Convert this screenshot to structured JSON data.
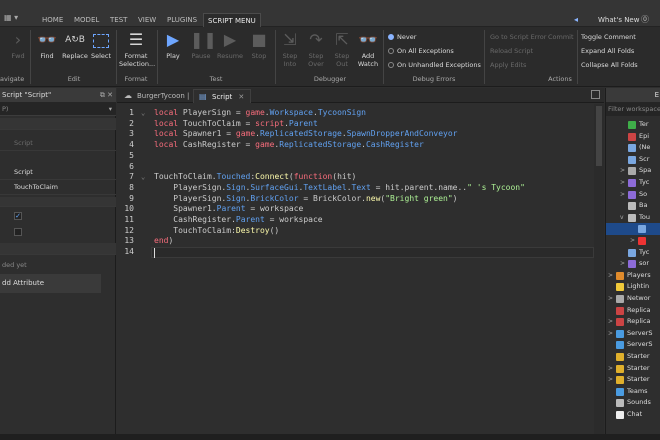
{
  "menubar": {
    "tabs": [
      "HOME",
      "MODEL",
      "TEST",
      "VIEW",
      "PLUGINS",
      "SCRIPT MENU"
    ],
    "active_tab": "SCRIPT MENU",
    "whats_new": "What's New"
  },
  "ribbon": {
    "navigate": {
      "fwd_label": "Fwd",
      "group": "avigate"
    },
    "edit": {
      "find": "Find",
      "replace": "Replace",
      "select": "Select",
      "group": "Edit"
    },
    "format": {
      "format_selection": "Format Selection...",
      "group": "Format"
    },
    "test": {
      "play": "Play",
      "pause": "Pause",
      "resume": "Resume",
      "stop": "Stop",
      "group": "Test"
    },
    "debugger": {
      "step_into": "Step Into",
      "step_over": "Step Over",
      "step_out": "Step Out",
      "add_watch": "Add Watch",
      "group": "Debugger"
    },
    "debug_errors": {
      "never": "Never",
      "all": "On All Exceptions",
      "unhandled": "On Unhandled Exceptions",
      "group": "Debug Errors"
    },
    "actions": {
      "goto": "Go to Script Error",
      "commit": "Commit",
      "reload": "Reload Script",
      "apply": "Apply Edits",
      "group": "Actions"
    },
    "folds": {
      "toggle": "Toggle Comment",
      "expand": "Expand All Folds",
      "collapse": "Collapse All Folds"
    }
  },
  "properties": {
    "title": "Script \"Script\"",
    "filter": "P)",
    "rows": [
      "Script",
      "Script",
      "TouchToClaim"
    ],
    "not_added": "ded yet",
    "add_attribute": "dd Attribute"
  },
  "editor": {
    "tabs": [
      "BurgerTycoon |",
      "Script"
    ],
    "lines": [
      [
        [
          "kw",
          "local "
        ],
        [
          "id",
          "PlayerSign = "
        ],
        [
          "kw",
          "game"
        ],
        [
          "id",
          "."
        ],
        [
          "pr",
          "Workspace"
        ],
        [
          "id",
          "."
        ],
        [
          "pr",
          "TycoonSign"
        ]
      ],
      [
        [
          "kw",
          "local "
        ],
        [
          "id",
          "TouchToClaim = "
        ],
        [
          "kw",
          "script"
        ],
        [
          "id",
          "."
        ],
        [
          "pr",
          "Parent"
        ]
      ],
      [
        [
          "kw",
          "local "
        ],
        [
          "id",
          "Spawner1 = "
        ],
        [
          "kw",
          "game"
        ],
        [
          "id",
          "."
        ],
        [
          "pr",
          "ReplicatedStorage"
        ],
        [
          "id",
          "."
        ],
        [
          "pr",
          "SpawnDropperAndConveyor"
        ]
      ],
      [
        [
          "kw",
          "local "
        ],
        [
          "id",
          "CashRegister = "
        ],
        [
          "kw",
          "game"
        ],
        [
          "id",
          "."
        ],
        [
          "pr",
          "ReplicatedStorage"
        ],
        [
          "id",
          "."
        ],
        [
          "pr",
          "CashRegister"
        ]
      ],
      [],
      [],
      [
        [
          "id",
          "TouchToClaim."
        ],
        [
          "pr",
          "Touched"
        ],
        [
          "id",
          ":"
        ],
        [
          "fn",
          "Connect"
        ],
        [
          "id",
          "("
        ],
        [
          "kw",
          "function"
        ],
        [
          "id",
          "(hit)"
        ]
      ],
      [
        [
          "id",
          "    PlayerSign."
        ],
        [
          "pr",
          "Sign"
        ],
        [
          "id",
          "."
        ],
        [
          "pr",
          "SurfaceGui"
        ],
        [
          "id",
          "."
        ],
        [
          "pr",
          "TextLabel"
        ],
        [
          "id",
          "."
        ],
        [
          "pr",
          "Text"
        ],
        [
          "id",
          " = hit.parent.name.."
        ],
        [
          "st",
          "\" 's Tycoon\""
        ]
      ],
      [
        [
          "id",
          "    PlayerSign."
        ],
        [
          "pr",
          "Sign"
        ],
        [
          "id",
          "."
        ],
        [
          "pr",
          "BrickColor"
        ],
        [
          "id",
          " = BrickColor."
        ],
        [
          "fn",
          "new"
        ],
        [
          "id",
          "("
        ],
        [
          "st",
          "\"Bright green\""
        ],
        [
          "id",
          ")"
        ]
      ],
      [
        [
          "id",
          "    Spawner1."
        ],
        [
          "pr",
          "Parent"
        ],
        [
          "id",
          " = workspace"
        ]
      ],
      [
        [
          "id",
          "    CashRegister."
        ],
        [
          "pr",
          "Parent"
        ],
        [
          "id",
          " = workspace"
        ]
      ],
      [
        [
          "id",
          "    TouchToClaim:"
        ],
        [
          "fn",
          "Destroy"
        ],
        [
          "id",
          "()"
        ]
      ],
      [
        [
          "kw",
          "end"
        ],
        [
          "id",
          ")"
        ]
      ],
      []
    ]
  },
  "explorer": {
    "title": "E",
    "filter": "Filter workspace",
    "items": [
      {
        "t": "Ter",
        "ind": 2,
        "ar": "",
        "c": "#3fae49"
      },
      {
        "t": "Epi",
        "ind": 2,
        "ar": "",
        "c": "#c44"
      },
      {
        "t": "(Ne",
        "ind": 2,
        "ar": "",
        "c": "#7aa7e0"
      },
      {
        "t": "Scr",
        "ind": 2,
        "ar": "",
        "c": "#7aa7e0"
      },
      {
        "t": "Spa",
        "ind": 2,
        "ar": ">",
        "c": "#aaa"
      },
      {
        "t": "Tyc",
        "ind": 2,
        "ar": ">",
        "c": "#8d6bd8"
      },
      {
        "t": "So",
        "ind": 2,
        "ar": ">",
        "c": "#8d6bd8"
      },
      {
        "t": "Ba",
        "ind": 2,
        "ar": "",
        "c": "#bbb"
      },
      {
        "t": "Tou",
        "ind": 2,
        "ar": "v",
        "c": "#bbb"
      },
      {
        "t": "",
        "ind": 3,
        "ar": "",
        "c": "#7aa7e0",
        "sel": true
      },
      {
        "t": "",
        "ind": 3,
        "ar": ">",
        "c": "#e33"
      },
      {
        "t": "Tyc",
        "ind": 2,
        "ar": "",
        "c": "#7aa7e0"
      },
      {
        "t": "sor",
        "ind": 2,
        "ar": ">",
        "c": "#8d6bd8"
      },
      {
        "t": "Players",
        "ind": 1,
        "ar": ">",
        "c": "#e08b2c"
      },
      {
        "t": "Lightin",
        "ind": 1,
        "ar": "",
        "c": "#f0c93a"
      },
      {
        "t": "Networ",
        "ind": 1,
        "ar": ">",
        "c": "#aaa"
      },
      {
        "t": "Replica",
        "ind": 1,
        "ar": "",
        "c": "#c44"
      },
      {
        "t": "Replica",
        "ind": 1,
        "ar": ">",
        "c": "#c44"
      },
      {
        "t": "ServerS",
        "ind": 1,
        "ar": ">",
        "c": "#4a9be0"
      },
      {
        "t": "ServerS",
        "ind": 1,
        "ar": "",
        "c": "#4a9be0"
      },
      {
        "t": "Starter",
        "ind": 1,
        "ar": "",
        "c": "#e0b02c"
      },
      {
        "t": "Starter",
        "ind": 1,
        "ar": ">",
        "c": "#e0b02c"
      },
      {
        "t": "Starter",
        "ind": 1,
        "ar": ">",
        "c": "#e0b02c"
      },
      {
        "t": "Teams",
        "ind": 1,
        "ar": "",
        "c": "#4a9be0"
      },
      {
        "t": "Sounds",
        "ind": 1,
        "ar": "",
        "c": "#bbb"
      },
      {
        "t": "Chat",
        "ind": 1,
        "ar": "",
        "c": "#eee"
      }
    ]
  },
  "colors": {
    "kw": "#f86d7c",
    "id": "#cccccc",
    "pr": "#61a1f1",
    "fn": "#fdfbac",
    "st": "#adf195"
  }
}
